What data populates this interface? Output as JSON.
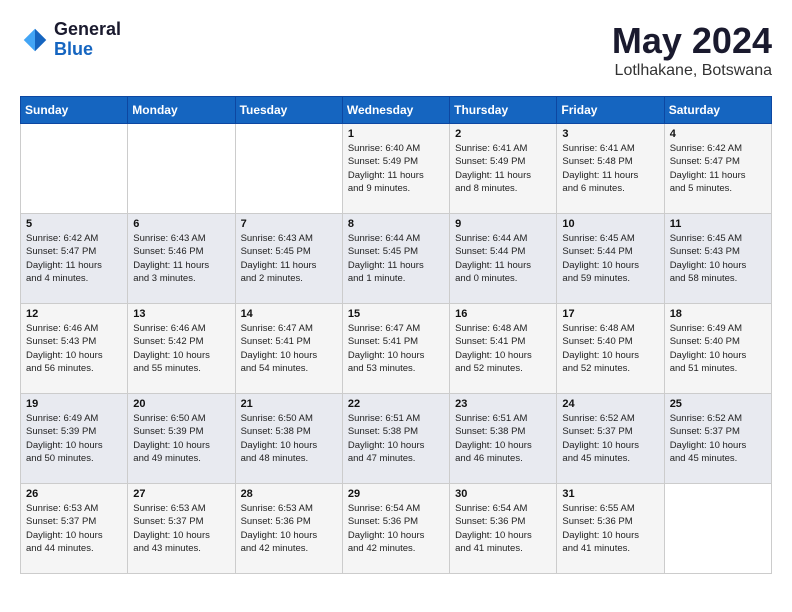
{
  "header": {
    "logo_general": "General",
    "logo_blue": "Blue",
    "month_title": "May 2024",
    "location": "Lotlhakane, Botswana"
  },
  "days_of_week": [
    "Sunday",
    "Monday",
    "Tuesday",
    "Wednesday",
    "Thursday",
    "Friday",
    "Saturday"
  ],
  "weeks": [
    [
      {
        "day": "",
        "info": ""
      },
      {
        "day": "",
        "info": ""
      },
      {
        "day": "",
        "info": ""
      },
      {
        "day": "1",
        "info": "Sunrise: 6:40 AM\nSunset: 5:49 PM\nDaylight: 11 hours\nand 9 minutes."
      },
      {
        "day": "2",
        "info": "Sunrise: 6:41 AM\nSunset: 5:49 PM\nDaylight: 11 hours\nand 8 minutes."
      },
      {
        "day": "3",
        "info": "Sunrise: 6:41 AM\nSunset: 5:48 PM\nDaylight: 11 hours\nand 6 minutes."
      },
      {
        "day": "4",
        "info": "Sunrise: 6:42 AM\nSunset: 5:47 PM\nDaylight: 11 hours\nand 5 minutes."
      }
    ],
    [
      {
        "day": "5",
        "info": "Sunrise: 6:42 AM\nSunset: 5:47 PM\nDaylight: 11 hours\nand 4 minutes."
      },
      {
        "day": "6",
        "info": "Sunrise: 6:43 AM\nSunset: 5:46 PM\nDaylight: 11 hours\nand 3 minutes."
      },
      {
        "day": "7",
        "info": "Sunrise: 6:43 AM\nSunset: 5:45 PM\nDaylight: 11 hours\nand 2 minutes."
      },
      {
        "day": "8",
        "info": "Sunrise: 6:44 AM\nSunset: 5:45 PM\nDaylight: 11 hours\nand 1 minute."
      },
      {
        "day": "9",
        "info": "Sunrise: 6:44 AM\nSunset: 5:44 PM\nDaylight: 11 hours\nand 0 minutes."
      },
      {
        "day": "10",
        "info": "Sunrise: 6:45 AM\nSunset: 5:44 PM\nDaylight: 10 hours\nand 59 minutes."
      },
      {
        "day": "11",
        "info": "Sunrise: 6:45 AM\nSunset: 5:43 PM\nDaylight: 10 hours\nand 58 minutes."
      }
    ],
    [
      {
        "day": "12",
        "info": "Sunrise: 6:46 AM\nSunset: 5:43 PM\nDaylight: 10 hours\nand 56 minutes."
      },
      {
        "day": "13",
        "info": "Sunrise: 6:46 AM\nSunset: 5:42 PM\nDaylight: 10 hours\nand 55 minutes."
      },
      {
        "day": "14",
        "info": "Sunrise: 6:47 AM\nSunset: 5:41 PM\nDaylight: 10 hours\nand 54 minutes."
      },
      {
        "day": "15",
        "info": "Sunrise: 6:47 AM\nSunset: 5:41 PM\nDaylight: 10 hours\nand 53 minutes."
      },
      {
        "day": "16",
        "info": "Sunrise: 6:48 AM\nSunset: 5:41 PM\nDaylight: 10 hours\nand 52 minutes."
      },
      {
        "day": "17",
        "info": "Sunrise: 6:48 AM\nSunset: 5:40 PM\nDaylight: 10 hours\nand 52 minutes."
      },
      {
        "day": "18",
        "info": "Sunrise: 6:49 AM\nSunset: 5:40 PM\nDaylight: 10 hours\nand 51 minutes."
      }
    ],
    [
      {
        "day": "19",
        "info": "Sunrise: 6:49 AM\nSunset: 5:39 PM\nDaylight: 10 hours\nand 50 minutes."
      },
      {
        "day": "20",
        "info": "Sunrise: 6:50 AM\nSunset: 5:39 PM\nDaylight: 10 hours\nand 49 minutes."
      },
      {
        "day": "21",
        "info": "Sunrise: 6:50 AM\nSunset: 5:38 PM\nDaylight: 10 hours\nand 48 minutes."
      },
      {
        "day": "22",
        "info": "Sunrise: 6:51 AM\nSunset: 5:38 PM\nDaylight: 10 hours\nand 47 minutes."
      },
      {
        "day": "23",
        "info": "Sunrise: 6:51 AM\nSunset: 5:38 PM\nDaylight: 10 hours\nand 46 minutes."
      },
      {
        "day": "24",
        "info": "Sunrise: 6:52 AM\nSunset: 5:37 PM\nDaylight: 10 hours\nand 45 minutes."
      },
      {
        "day": "25",
        "info": "Sunrise: 6:52 AM\nSunset: 5:37 PM\nDaylight: 10 hours\nand 45 minutes."
      }
    ],
    [
      {
        "day": "26",
        "info": "Sunrise: 6:53 AM\nSunset: 5:37 PM\nDaylight: 10 hours\nand 44 minutes."
      },
      {
        "day": "27",
        "info": "Sunrise: 6:53 AM\nSunset: 5:37 PM\nDaylight: 10 hours\nand 43 minutes."
      },
      {
        "day": "28",
        "info": "Sunrise: 6:53 AM\nSunset: 5:36 PM\nDaylight: 10 hours\nand 42 minutes."
      },
      {
        "day": "29",
        "info": "Sunrise: 6:54 AM\nSunset: 5:36 PM\nDaylight: 10 hours\nand 42 minutes."
      },
      {
        "day": "30",
        "info": "Sunrise: 6:54 AM\nSunset: 5:36 PM\nDaylight: 10 hours\nand 41 minutes."
      },
      {
        "day": "31",
        "info": "Sunrise: 6:55 AM\nSunset: 5:36 PM\nDaylight: 10 hours\nand 41 minutes."
      },
      {
        "day": "",
        "info": ""
      }
    ]
  ]
}
